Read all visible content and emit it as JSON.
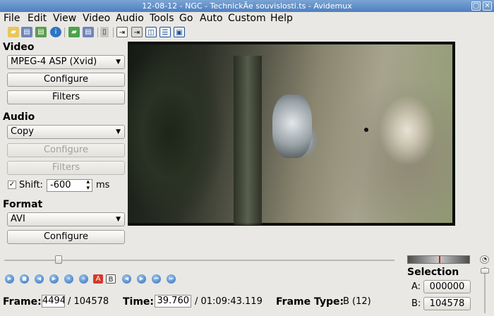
{
  "window": {
    "title": "12-08-12 - NGC - TechnickÃe souvislosti.ts - Avidemux",
    "restore_glyph": "▢",
    "close_glyph": "✕"
  },
  "menu": [
    "File",
    "Edit",
    "View",
    "Video",
    "Audio",
    "Tools",
    "Go",
    "Auto",
    "Custom",
    "Help"
  ],
  "toolbar_icons": [
    "open-icon",
    "save-icon",
    "save-as-icon",
    "info-icon",
    "open-video-icon",
    "save-video-icon",
    "calculator-icon",
    "input-view-icon",
    "output-view-icon",
    "side-by-side-icon",
    "top-bottom-icon",
    "preview-icon"
  ],
  "video": {
    "title": "Video",
    "codec": "MPEG-4 ASP (Xvid)",
    "configure_label": "Configure",
    "filters_label": "Filters"
  },
  "audio": {
    "title": "Audio",
    "codec": "Copy",
    "configure_label": "Configure",
    "filters_label": "Filters",
    "shift_label": "Shift:",
    "shift_value": "-600",
    "shift_unit": "ms",
    "shift_checked": true
  },
  "format": {
    "title": "Format",
    "container": "AVI",
    "configure_label": "Configure"
  },
  "status": {
    "frame_label": "Frame:",
    "frame_value": "4494",
    "frame_total": "/ 104578",
    "time_label": "Time:",
    "time_value": "39.760",
    "time_total": "/ 01:09:43.119",
    "frame_type_label": "Frame Type:",
    "frame_type_value": "B (12)"
  },
  "selection": {
    "title": "Selection",
    "a_label": "A:",
    "a_value": "000000",
    "b_label": "B:",
    "b_value": "104578"
  },
  "playback": {
    "slider_position": 0.143
  }
}
